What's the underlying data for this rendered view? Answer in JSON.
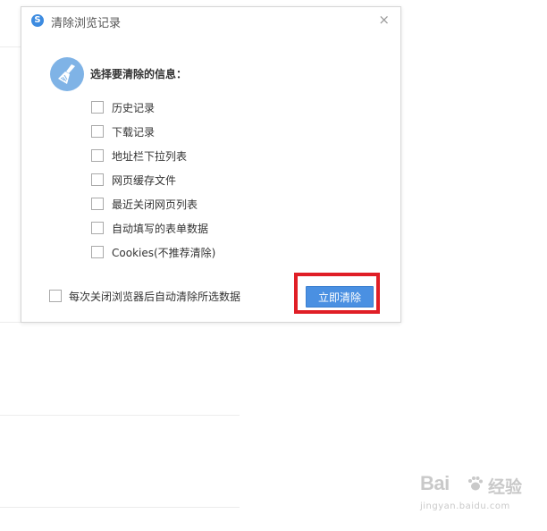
{
  "dialog": {
    "title": "清除浏览记录",
    "close_symbol": "×",
    "heading": "选择要清除的信息：",
    "options": [
      {
        "label": "历史记录",
        "checked": false
      },
      {
        "label": "下载记录",
        "checked": false
      },
      {
        "label": "地址栏下拉列表",
        "checked": false
      },
      {
        "label": "网页缓存文件",
        "checked": false
      },
      {
        "label": "最近关闭网页列表",
        "checked": false
      },
      {
        "label": "自动填写的表单数据",
        "checked": false
      },
      {
        "label": "Cookies(不推荐清除)",
        "checked": false
      }
    ],
    "auto_clear_label": "每次关闭浏览器后自动清除所选数据",
    "clear_button_label": "立即清除"
  },
  "watermark": {
    "brand": "Bai",
    "brand_suffix": "经验",
    "url": "jingyan.baidu.com"
  },
  "colors": {
    "accent": "#4a90e2",
    "highlight": "#e01e26"
  },
  "icons": {
    "app": "browser-logo-icon",
    "broom": "broom-icon",
    "close": "close-icon"
  }
}
